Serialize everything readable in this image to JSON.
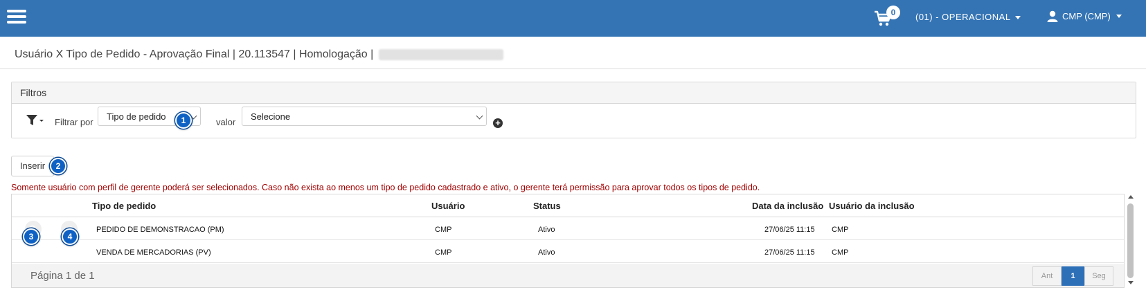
{
  "header": {
    "cart_count": "0",
    "company": "(01) - OPERACIONAL",
    "user": "CMP (CMP)"
  },
  "page": {
    "title": "Usuário X Tipo de Pedido - Aprovação Final | 20.113547 | Homologação |"
  },
  "filters": {
    "title": "Filtros",
    "filter_by_label": "Filtrar por",
    "filter_field": "Tipo de pedido",
    "value_label": "valor",
    "value_placeholder": "Selecione"
  },
  "toolbar": {
    "insert_label": "Inserir"
  },
  "warning": "Somente usuário com perfil de gerente poderá ser selecionados. Caso não exista ao menos um tipo de pedido cadastrado e ativo, o gerente terá permissão para aprovar todos os tipos de pedido.",
  "table": {
    "columns": {
      "tipo": "Tipo de pedido",
      "usuario": "Usuário",
      "status": "Status",
      "data": "Data da inclusão",
      "usuario_inclusao": "Usuário da inclusão"
    },
    "rows": [
      {
        "tipo": "PEDIDO DE DEMONSTRACAO (PM)",
        "usuario": "CMP",
        "status": "Ativo",
        "data": "27/06/25 11:15",
        "usuario_inclusao": "CMP"
      },
      {
        "tipo": "VENDA DE MERCADORIAS (PV)",
        "usuario": "CMP",
        "status": "Ativo",
        "data": "27/06/25 11:15",
        "usuario_inclusao": "CMP"
      }
    ],
    "page_info": "Página 1 de 1",
    "pager": {
      "prev": "Ant",
      "current": "1",
      "next": "Seg"
    }
  },
  "markers": {
    "m1": "1",
    "m2": "2",
    "m3": "3",
    "m4": "4"
  },
  "colors": {
    "topbar": "#3474b4",
    "marker": "#0f62c4",
    "warning": "#a30000",
    "pager_active": "#2d70b7"
  }
}
